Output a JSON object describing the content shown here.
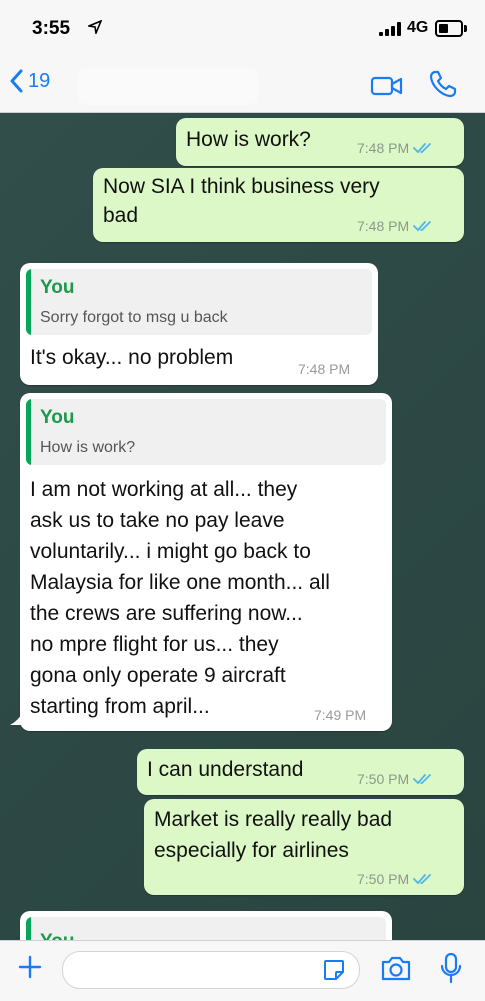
{
  "status_bar": {
    "time": "3:55",
    "network": "4G"
  },
  "nav": {
    "back_count": "19"
  },
  "messages": [
    {
      "text": "How is work?",
      "time": "7:48 PM"
    },
    {
      "text_lines": [
        "Now SIA I think business very",
        "bad"
      ],
      "time": "7:48 PM"
    },
    {
      "quote_author": "You",
      "quote_text": "Sorry forgot to msg u back",
      "text": "It's okay... no problem",
      "time": "7:48 PM"
    },
    {
      "quote_author": "You",
      "quote_text": "How is work?",
      "text_lines": [
        "I am not working at all... they",
        "ask us to take no pay leave",
        "voluntarily... i might go back to",
        "Malaysia for like one month... all",
        "the crews are suffering now...",
        "no mpre flight for us... they",
        "gona only operate 9 aircraft",
        "starting from april..."
      ],
      "time": "7:49 PM"
    },
    {
      "text": "I can understand",
      "time": "7:50 PM"
    },
    {
      "text_lines": [
        "Market is really really bad",
        "especially for airlines"
      ],
      "time": "7:50 PM"
    },
    {
      "quote_author": "You"
    }
  ],
  "colors": {
    "outgoing": "#dcf8c6",
    "incoming": "#ffffff",
    "accent": "#1a7cf5",
    "read_ticks": "#4fb6ec",
    "quote_author": "#1a9a4a"
  },
  "icons": {
    "back": "chevron-left-icon",
    "video": "video-camera-icon",
    "call": "phone-icon",
    "attach": "plus-icon",
    "sticker": "sticker-icon",
    "camera": "camera-icon",
    "mic": "microphone-icon",
    "read": "double-check-icon",
    "location": "location-arrow-icon"
  }
}
